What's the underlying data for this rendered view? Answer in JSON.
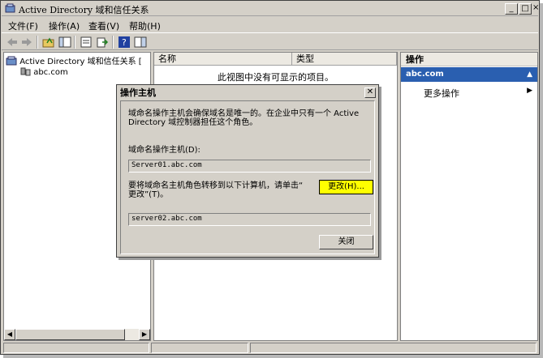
{
  "window": {
    "title": "Active Directory 域和信任关系"
  },
  "menu": [
    "文件(F)",
    "操作(A)",
    "查看(V)",
    "帮助(H)"
  ],
  "tree": {
    "root": "Active Directory 域和信任关系 [",
    "child": "abc.com"
  },
  "list": {
    "col_name": "名称",
    "col_type": "类型",
    "empty": "此视图中没有可显示的项目。"
  },
  "actions": {
    "header": "操作",
    "selected": "abc.com",
    "more": "更多操作"
  },
  "dialog": {
    "title": "操作主机",
    "desc_line1": "域命名操作主机会确保域名是唯一的。在企业中只有一个 Active",
    "desc_line2": "Directory 域控制器担任这个角色。",
    "owner_label": "域命名操作主机(D):",
    "owner_value": "Server01.abc.com",
    "transfer_line1": "要将域命名主机角色转移到以下计算机，请单击“",
    "transfer_line2": "更改”(T)。",
    "change_button": "更改(H)...",
    "target_value": "server02.abc.com",
    "close_button": "关闭"
  },
  "colors": {
    "selection": "#2a5fb0",
    "highlight": "#ffff00",
    "face": "#d4d0c8"
  }
}
